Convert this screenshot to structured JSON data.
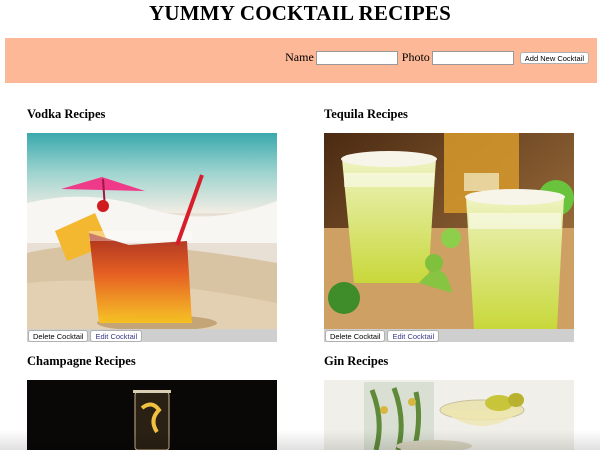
{
  "page": {
    "title": "YUMMY COCKTAIL RECIPES"
  },
  "form": {
    "name_label": "Name",
    "name_value": "",
    "photo_label": "Photo",
    "photo_value": "",
    "add_button": "Add New Cocktail"
  },
  "cards": [
    {
      "title": "Vodka Recipes",
      "delete_label": "Delete Cocktail",
      "edit_label": "Edit Cocktail",
      "photo": "vodka-cocktail-beach-photo"
    },
    {
      "title": "Tequila Recipes",
      "delete_label": "Delete Cocktail",
      "edit_label": "Edit Cocktail",
      "photo": "tequila-margarita-photo"
    },
    {
      "title": "Champagne Recipes",
      "photo": "champagne-cocktail-photo"
    },
    {
      "title": "Gin Recipes",
      "photo": "gin-martini-photo"
    }
  ],
  "colors": {
    "header_band": "#fdb897",
    "button_bar": "#cfcfcf"
  }
}
